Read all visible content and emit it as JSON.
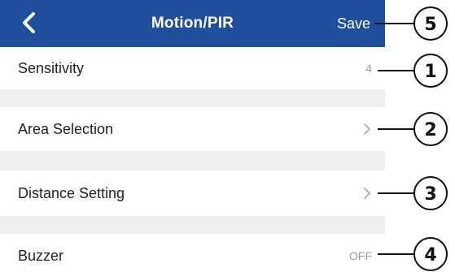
{
  "header": {
    "title": "Motion/PIR",
    "save_label": "Save",
    "bar_color": "#1f4f9c"
  },
  "settings": [
    {
      "label": "Sensitivity",
      "value": "4",
      "control": "value"
    },
    {
      "label": "Area Selection",
      "value": "",
      "control": "chevron-right-icon"
    },
    {
      "label": "Distance Setting",
      "value": "",
      "control": "chevron-right-icon"
    },
    {
      "label": "Buzzer",
      "value": "OFF",
      "control": "value"
    }
  ],
  "callouts": {
    "sensitivity": "1",
    "area_selection": "2",
    "distance_setting": "3",
    "buzzer": "4",
    "save": "5"
  }
}
